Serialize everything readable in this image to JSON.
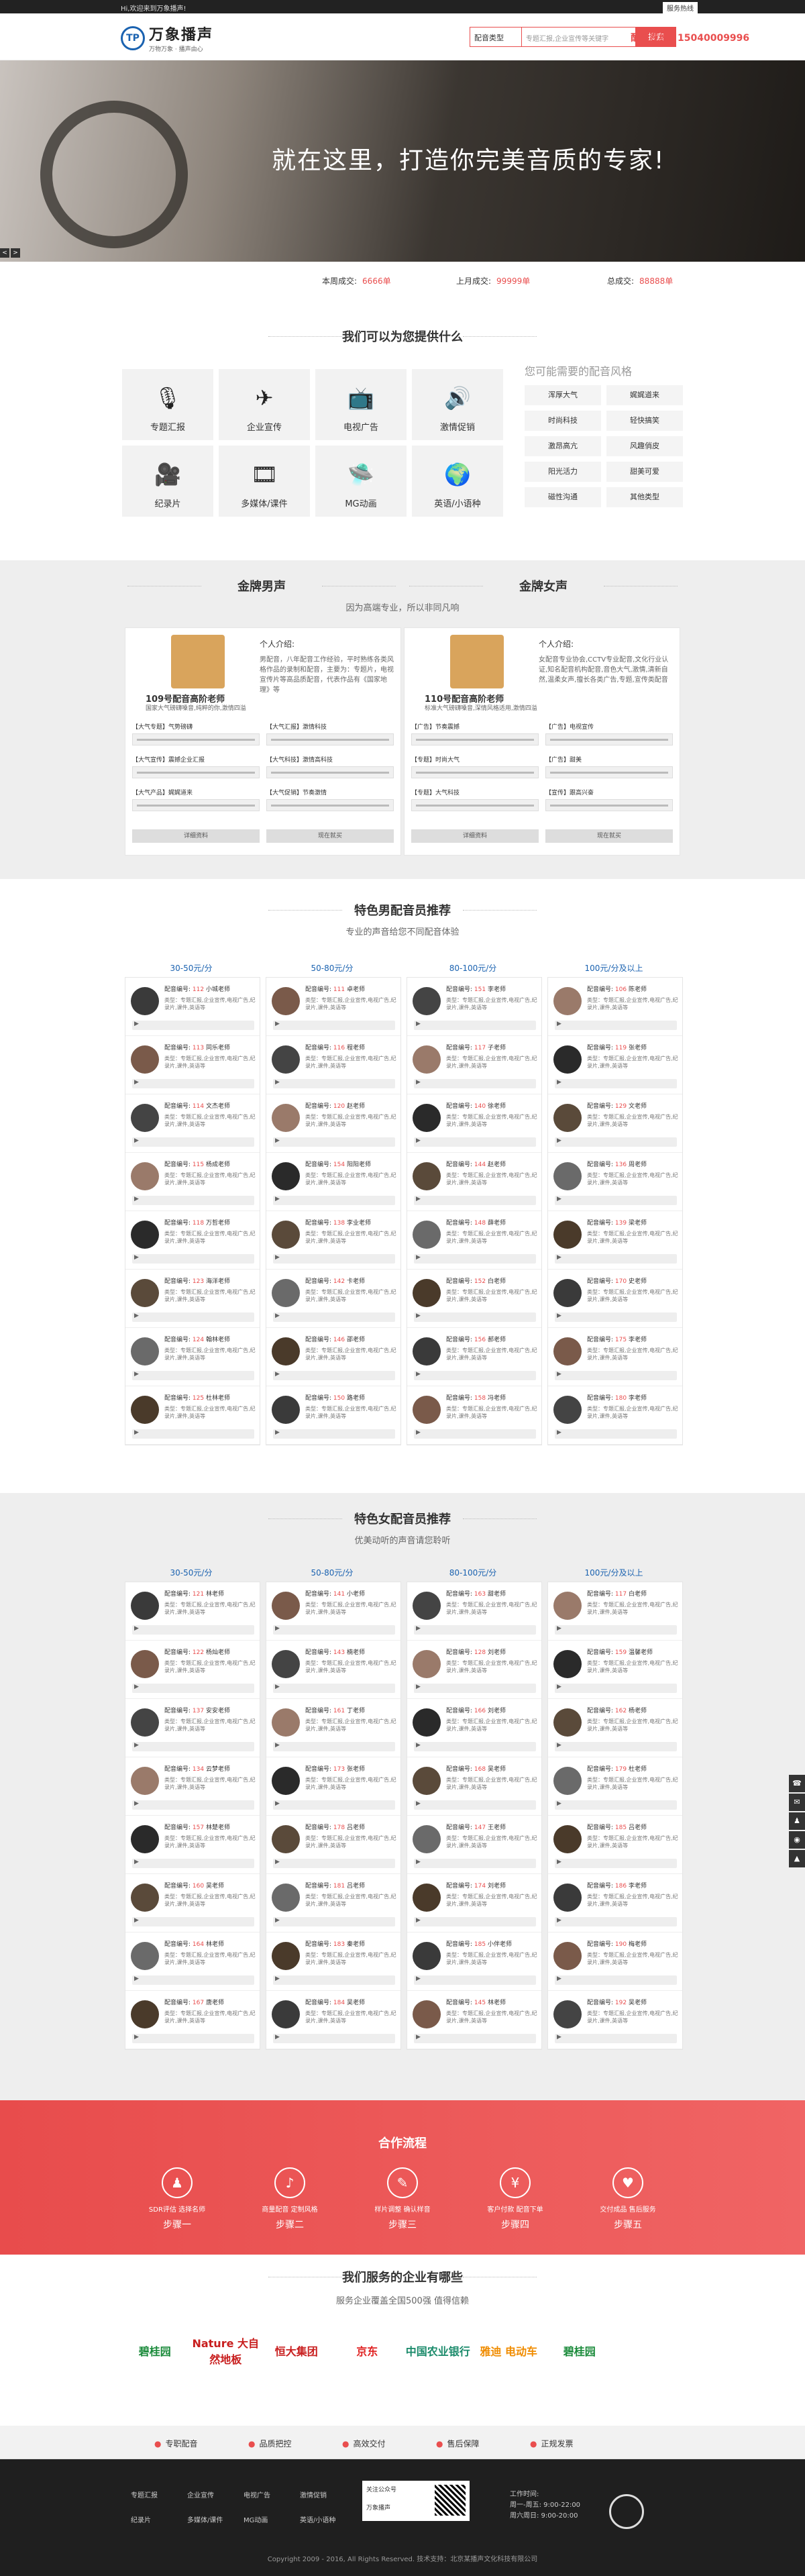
{
  "topbar": {
    "welcome": "Hi,欢迎来到万象播声!",
    "btn": "服务热线"
  },
  "header": {
    "logo_mark": "TP",
    "logo_name": "万象播声",
    "logo_slogan": "万物万象 · 播声由心",
    "search_select": "配音类型",
    "search_placeholder": "专题汇报,企业宣传等关键字",
    "search_btn": "搜索",
    "hotline": "配音专线：15040009996"
  },
  "banner": {
    "headline": "就在这里，打造你完美音质的专家!",
    "prev": "<",
    "next": ">"
  },
  "stats": [
    {
      "label": "本周成交:",
      "value": "6666单"
    },
    {
      "label": "上月成交:",
      "value": "99999单"
    },
    {
      "label": "总成交:",
      "value": "88888单"
    }
  ],
  "services": {
    "title": "我们可以为您提供什么",
    "items": [
      {
        "icon": "microphone-icon",
        "glyph": "🎙",
        "label": "专题汇报"
      },
      {
        "icon": "paper-plane-icon",
        "glyph": "✈",
        "label": "企业宣传"
      },
      {
        "icon": "tv-icon",
        "glyph": "📺",
        "label": "电视广告"
      },
      {
        "icon": "speaker-icon",
        "glyph": "🔊",
        "label": "激情促销"
      },
      {
        "icon": "video-camera-icon",
        "glyph": "🎥",
        "label": "纪录片"
      },
      {
        "icon": "film-icon",
        "glyph": "🎞",
        "label": "多媒体/课件"
      },
      {
        "icon": "ufo-icon",
        "glyph": "🛸",
        "label": "MG动画"
      },
      {
        "icon": "globe-icon",
        "glyph": "🌍",
        "label": "英语/小语种"
      }
    ],
    "styles_title": "您可能需要的配音风格",
    "styles": [
      "浑厚大气",
      "娓娓道来",
      "时尚科技",
      "轻快搞笑",
      "激昂高亢",
      "风趣俏皮",
      "阳光活力",
      "甜美可爱",
      "磁性沟通",
      "其他类型"
    ]
  },
  "gold": {
    "male_title": "金牌男声",
    "female_title": "金牌女声",
    "subtitle": "因为高端专业，所以非同凡响",
    "cards": [
      {
        "name": "109号配音高阶老师",
        "desc": "国家大气磅礴嗓音,纯粹的你,激情四溢",
        "intro_title": "个人介绍:",
        "intro": "男配音，八年配音工作经验，平时熟练各类风格作品的录制和配音，主要为：专题片，电视宣传片等高品质配音，代表作品有《国家地理》等",
        "tracks": [
          "【大气专题】气势磅礴",
          "【大气汇报】激情科技",
          "【大气宣传】震撼企业汇报",
          "【大气科技】激情高科技",
          "【大气产品】娓娓道来",
          "【大气促销】节奏激情"
        ],
        "btn_detail": "详细资料",
        "btn_order": "现在就买"
      },
      {
        "name": "110号配音高阶老师",
        "desc": "标准大气磅礴嗓音,深情风格适用,激情四溢",
        "intro_title": "个人介绍:",
        "intro": "女配音专业协会,CCTV专业配音,文化行业认证,知名配音机构配音,音色大气,激情,清新自然,温柔女声,擅长各类广告,专题,宣传类配音",
        "tracks": [
          "【广告】节奏震撼",
          "【广告】电视宣传",
          "【专题】时尚大气",
          "【广告】甜美",
          "【专题】大气科技",
          "【宣传】跟高兴奋"
        ],
        "btn_detail": "详细资料",
        "btn_order": "现在就买"
      }
    ]
  },
  "male": {
    "title": "特色男配音员推荐",
    "subtitle": "专业的声音给您不同配音体验",
    "prices": [
      "30-50元/分",
      "50-80元/分",
      "80-100元/分",
      "100元/分及以上"
    ],
    "columns": [
      [
        [
          "112",
          "小城老师"
        ],
        [
          "113",
          "同乐老师"
        ],
        [
          "114",
          "文杰老师"
        ],
        [
          "115",
          "杨成老师"
        ],
        [
          "118",
          "万哲老师"
        ],
        [
          "123",
          "海洋老师"
        ],
        [
          "124",
          "翰林老师"
        ],
        [
          "125",
          "杜林老师"
        ]
      ],
      [
        [
          "111",
          "卓老师"
        ],
        [
          "116",
          "程老师"
        ],
        [
          "120",
          "赵老师"
        ],
        [
          "154",
          "阳阳老师"
        ],
        [
          "138",
          "李业老师"
        ],
        [
          "142",
          "卡老师"
        ],
        [
          "146",
          "邵老师"
        ],
        [
          "150",
          "路老师"
        ]
      ],
      [
        [
          "151",
          "李老师"
        ],
        [
          "117",
          "子老师"
        ],
        [
          "140",
          "徐老师"
        ],
        [
          "144",
          "赵老师"
        ],
        [
          "148",
          "薛老师"
        ],
        [
          "152",
          "白老师"
        ],
        [
          "156",
          "郝老师"
        ],
        [
          "158",
          "冯老师"
        ]
      ],
      [
        [
          "106",
          "陈老师"
        ],
        [
          "119",
          "张老师"
        ],
        [
          "129",
          "文老师"
        ],
        [
          "136",
          "周老师"
        ],
        [
          "139",
          "梁老师"
        ],
        [
          "170",
          "史老师"
        ],
        [
          "175",
          "李老师"
        ],
        [
          "180",
          "李老师"
        ]
      ]
    ],
    "type_text": "类型：专题汇报,企业宣传,电视广告,纪录片,课件,英语等"
  },
  "female": {
    "title": "特色女配音员推荐",
    "subtitle": "优美动听的声音请您聆听",
    "prices": [
      "30-50元/分",
      "50-80元/分",
      "80-100元/分",
      "100元/分及以上"
    ],
    "columns": [
      [
        [
          "121",
          "林老师"
        ],
        [
          "122",
          "杨灿老师"
        ],
        [
          "137",
          "安安老师"
        ],
        [
          "134",
          "云梦老师"
        ],
        [
          "157",
          "林楚老师"
        ],
        [
          "160",
          "吴老师"
        ],
        [
          "164",
          "林老师"
        ],
        [
          "167",
          "唐老师"
        ]
      ],
      [
        [
          "141",
          "小老师"
        ],
        [
          "143",
          "楠老师"
        ],
        [
          "161",
          "丁老师"
        ],
        [
          "173",
          "张老师"
        ],
        [
          "178",
          "吕老师"
        ],
        [
          "181",
          "吕老师"
        ],
        [
          "183",
          "秦老师"
        ],
        [
          "184",
          "吴老师"
        ]
      ],
      [
        [
          "163",
          "甜老师"
        ],
        [
          "128",
          "刘老师"
        ],
        [
          "166",
          "刘老师"
        ],
        [
          "168",
          "吴老师"
        ],
        [
          "147",
          "王老师"
        ],
        [
          "174",
          "刘老师"
        ],
        [
          "185",
          "小伴老师"
        ],
        [
          "145",
          "林老师"
        ]
      ],
      [
        [
          "117",
          "白老师"
        ],
        [
          "159",
          "温馨老师"
        ],
        [
          "162",
          "杨老师"
        ],
        [
          "179",
          "杜老师"
        ],
        [
          "185",
          "吕老师"
        ],
        [
          "186",
          "李老师"
        ],
        [
          "190",
          "梅老师"
        ],
        [
          "192",
          "吴老师"
        ]
      ]
    ],
    "type_text": "类型：专题汇报,企业宣传,电视广告,纪录片,课件,英语等"
  },
  "process": {
    "title": "合作流程",
    "steps": [
      {
        "glyph": "♟",
        "desc": "SDR评估 选择名师",
        "step": "步骤一"
      },
      {
        "glyph": "♪",
        "desc": "商量配音 定制风格",
        "step": "步骤二"
      },
      {
        "glyph": "✎",
        "desc": "样片调整 确认样音",
        "step": "步骤三"
      },
      {
        "glyph": "¥",
        "desc": "客户付款 配音下单",
        "step": "步骤四"
      },
      {
        "glyph": "♥",
        "desc": "交付成品 售后服务",
        "step": "步骤五"
      }
    ]
  },
  "clients": {
    "title": "我们服务的企业有哪些",
    "subtitle": "服务企业覆盖全国500强 值得信赖",
    "logos": [
      {
        "name": "碧桂园",
        "color": "#1a8a3a"
      },
      {
        "name": "Nature 大自然地板",
        "color": "#c81e1e"
      },
      {
        "name": "恒大集团",
        "color": "#c81e1e"
      },
      {
        "name": "京东",
        "color": "#e02424"
      },
      {
        "name": "中国农业银行",
        "color": "#1a8a6a"
      },
      {
        "name": "雅迪 电动车",
        "color": "#f08c00"
      },
      {
        "name": "碧桂园",
        "color": "#1a8a3a"
      }
    ]
  },
  "guarantees": [
    "专职配音",
    "品质把控",
    "高效交付",
    "售后保障",
    "正规发票"
  ],
  "footer": {
    "links": [
      "专题汇报",
      "企业宣传",
      "电视广告",
      "激情促销",
      "纪录片",
      "多媒体/课件",
      "MG动画",
      "英语/小语种"
    ],
    "qr_text": "关注公众号",
    "qr_name": "万象播声",
    "hours_title": "工作时间:",
    "hours1": "周一-周五:  9:00-22:00",
    "hours2": "周六周日:  9:00-20:00",
    "copyright": "Copyright 2009 - 2016, All Rights Reserved. 技术支持：北京某播声文化科技有限公司"
  }
}
